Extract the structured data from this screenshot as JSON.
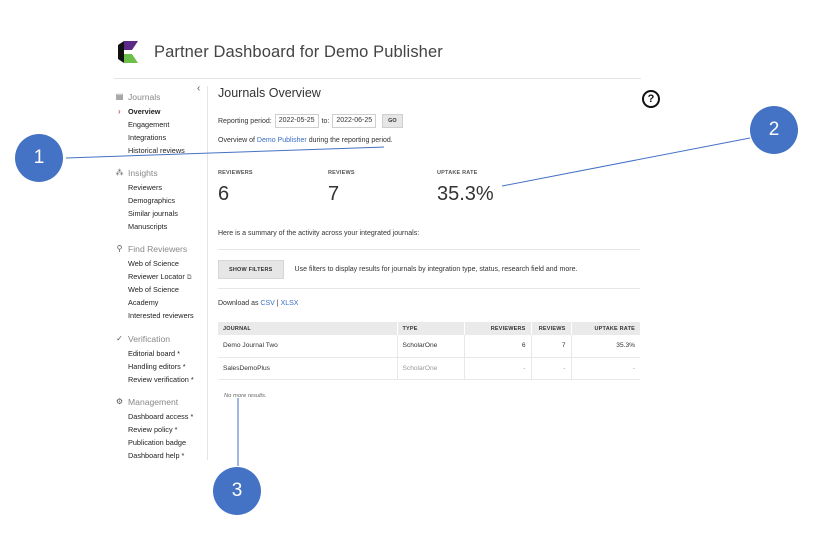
{
  "header": {
    "title": "Partner Dashboard for Demo Publisher"
  },
  "sidebar": {
    "collapse_glyph": "‹",
    "sections": [
      {
        "title": "Journals",
        "icon": "journals-icon",
        "items": [
          "Overview",
          "Engagement",
          "Integrations",
          "Historical reviews"
        ],
        "active": "Overview"
      },
      {
        "title": "Insights",
        "icon": "insights-icon",
        "items": [
          "Reviewers",
          "Demographics",
          "Similar journals",
          "Manuscripts"
        ]
      },
      {
        "title": "Find Reviewers",
        "icon": "search-icon",
        "items": [
          "Web of Science",
          "Reviewer Locator",
          "Web of Science",
          "Academy",
          "Interested reviewers"
        ]
      },
      {
        "title": "Verification",
        "icon": "check-icon",
        "items": [
          "Editorial board *",
          "Handling editors *",
          "Review verification *"
        ]
      },
      {
        "title": "Management",
        "icon": "gear-icon",
        "items": [
          "Dashboard access *",
          "Review policy *",
          "Publication badge",
          "Dashboard help *"
        ]
      }
    ]
  },
  "main": {
    "title": "Journals Overview",
    "period": {
      "label": "Reporting period:",
      "from": "2022-05-25",
      "to_label": "to:",
      "to": "2022-06-25",
      "go_label": "GO"
    },
    "overview": {
      "prefix": "Overview of",
      "publisher": "Demo Publisher",
      "suffix": "during the reporting period."
    },
    "stats": [
      {
        "label": "REVIEWERS",
        "value": "6"
      },
      {
        "label": "REVIEWS",
        "value": "7"
      },
      {
        "label": "UPTAKE RATE",
        "value": "35.3%"
      }
    ],
    "summary": "Here is a summary of the activity across your integrated journals:",
    "filters": {
      "button": "SHOW FILTERS",
      "help": "Use filters to display results for journals by integration type, status, research field and more."
    },
    "download": {
      "label": "Download as",
      "csv": "CSV",
      "sep": "|",
      "xlsx": "XLSX"
    },
    "table": {
      "columns": [
        "JOURNAL",
        "TYPE",
        "REVIEWERS",
        "REVIEWS",
        "UPTAKE RATE"
      ],
      "rows": [
        [
          "Demo Journal Two",
          "ScholarOne",
          "6",
          "7",
          "35.3%"
        ],
        [
          "SalesDemoPlus",
          "ScholarOne",
          "-",
          "-",
          "-"
        ]
      ]
    },
    "no_more": "No more results."
  },
  "help_icon": {
    "glyph": "?"
  },
  "callouts": [
    "1",
    "2",
    "3"
  ],
  "colors": {
    "callout": "#4472c4",
    "link": "#3a6fc4",
    "active_caret": "#d9534f"
  }
}
